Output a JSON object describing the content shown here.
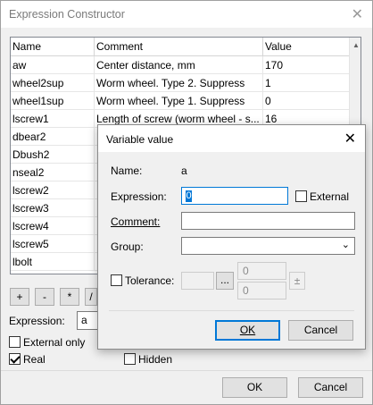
{
  "window": {
    "title": "Expression Constructor",
    "close_glyph": "✕"
  },
  "table": {
    "headers": [
      "Name",
      "Comment",
      "Value"
    ],
    "rows": [
      [
        "aw",
        " Center distance, mm",
        "170"
      ],
      [
        "wheel2sup",
        "Worm wheel. Type 2. Suppress",
        "1"
      ],
      [
        "wheel1sup",
        " Worm wheel. Type 1. Suppress",
        "0"
      ],
      [
        "lscrew1",
        "Length of screw (worm wheel - s...",
        "16"
      ],
      [
        "dbear2",
        "",
        ""
      ],
      [
        "Dbush2",
        "",
        ""
      ],
      [
        "nseal2",
        "",
        ""
      ],
      [
        "lscrew2",
        "",
        ""
      ],
      [
        "lscrew3",
        "",
        ""
      ],
      [
        "lscrew4",
        "",
        ""
      ],
      [
        "lscrew5",
        "",
        ""
      ],
      [
        "lbolt",
        "",
        ""
      ]
    ]
  },
  "operators": [
    "+",
    "-",
    "*",
    "/"
  ],
  "main": {
    "expression_label": "Expression:",
    "expression_value": "a",
    "external_only_label": "External only",
    "real_label": "Real",
    "hidden_label": "Hidden",
    "ok_label": "OK",
    "cancel_label": "Cancel"
  },
  "dialog": {
    "title": "Variable value",
    "close_glyph": "✕",
    "name_label": "Name:",
    "name_value": "a",
    "expression_label": "Expression:",
    "expression_value": "0",
    "external_label": "External",
    "comment_label": "Comment:",
    "group_label": "Group:",
    "tolerance_label": "Tolerance:",
    "ellipsis_label": "...",
    "tol_upper": "0",
    "tol_lower": "0",
    "plusminus": "±",
    "ok_label": "OK",
    "cancel_label": "Cancel"
  }
}
